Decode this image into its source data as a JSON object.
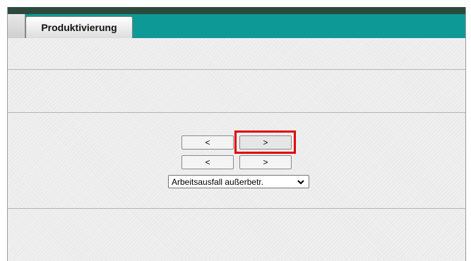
{
  "tab": {
    "label": "Produktivierung"
  },
  "nav": {
    "prev_top_label": "<",
    "next_top_label": ">",
    "prev_bottom_label": "<",
    "next_bottom_label": ">"
  },
  "select": {
    "value": "Arbeitsausfall außerbetr."
  },
  "colors": {
    "top_band": "#2c4a3c",
    "tab_bar": "#0d9a96",
    "highlight": "#e00000",
    "panel": "#ededed"
  },
  "icons": {
    "select_arrow": "chevron-down-icon"
  }
}
